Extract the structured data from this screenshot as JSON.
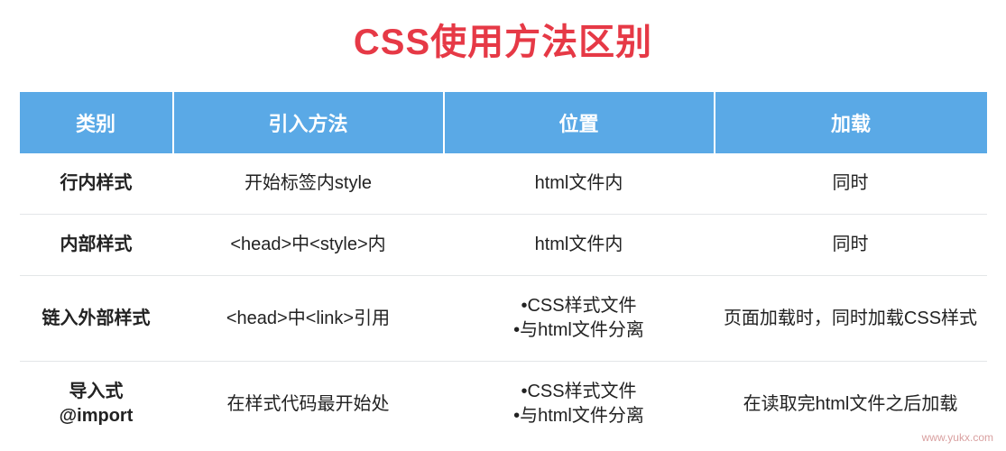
{
  "title": "CSS使用方法区别",
  "headers": {
    "category": "类别",
    "method": "引入方法",
    "position": "位置",
    "load": "加载"
  },
  "rows": [
    {
      "category": "行内样式",
      "method": "开始标签内style",
      "position": "html文件内",
      "load": "同时"
    },
    {
      "category": "内部样式",
      "method": "<head>中<style>内",
      "position": "html文件内",
      "load": "同时"
    },
    {
      "category": "链入外部样式",
      "method": "<head>中<link>引用",
      "position": "•CSS样式文件\n•与html文件分离",
      "load": "页面加载时，同时加载CSS样式"
    },
    {
      "category": "导入式\n@import",
      "method": "在样式代码最开始处",
      "position": "•CSS样式文件\n•与html文件分离",
      "load": "在读取完html文件之后加载"
    }
  ],
  "watermark": "www.yukx.com",
  "chart_data": {
    "type": "table",
    "title": "CSS使用方法区别",
    "columns": [
      "类别",
      "引入方法",
      "位置",
      "加载"
    ],
    "rows": [
      [
        "行内样式",
        "开始标签内style",
        "html文件内",
        "同时"
      ],
      [
        "内部样式",
        "<head>中<style>内",
        "html文件内",
        "同时"
      ],
      [
        "链入外部样式",
        "<head>中<link>引用",
        "•CSS样式文件 •与html文件分离",
        "页面加载时，同时加载CSS样式"
      ],
      [
        "导入式 @import",
        "在样式代码最开始处",
        "•CSS样式文件 •与html文件分离",
        "在读取完html文件之后加载"
      ]
    ]
  }
}
